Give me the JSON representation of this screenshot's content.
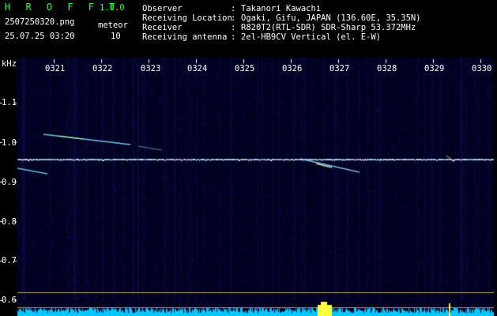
{
  "app": {
    "name": "H R O F F T",
    "version": "1.0.0"
  },
  "file": {
    "name": "2507250320.png",
    "datetime": "25.07.25 03:20"
  },
  "meteor": {
    "label": "meteor",
    "count": "10"
  },
  "info": [
    {
      "key": "Observer",
      "value": "Takanori Kawachi"
    },
    {
      "key": "Receiving Location",
      "value": "Ogaki, Gifu, JAPAN (136.60E, 35.35N)"
    },
    {
      "key": "Receiver",
      "value": "R820T2(RTL-SDR) SDR-Sharp 53.372MHz"
    },
    {
      "key": "Receiving antenna",
      "value": "2el-HB9CV Vertical (el. E-W)"
    }
  ],
  "axis": {
    "unit": "kHz",
    "time_ticks": [
      "0321",
      "0322",
      "0323",
      "0324",
      "0325",
      "0326",
      "0327",
      "0328",
      "0329",
      "0330"
    ],
    "freq_ticks": [
      "1.1",
      "1.0",
      "0.9",
      "0.8",
      "0.7",
      "0.6"
    ]
  },
  "colors": {
    "background": "#000020",
    "title_green": "#2bff2b",
    "carrier": "#cfe6ff",
    "baseline_noise": "#00c8ff",
    "burst": "#ffff40"
  }
}
